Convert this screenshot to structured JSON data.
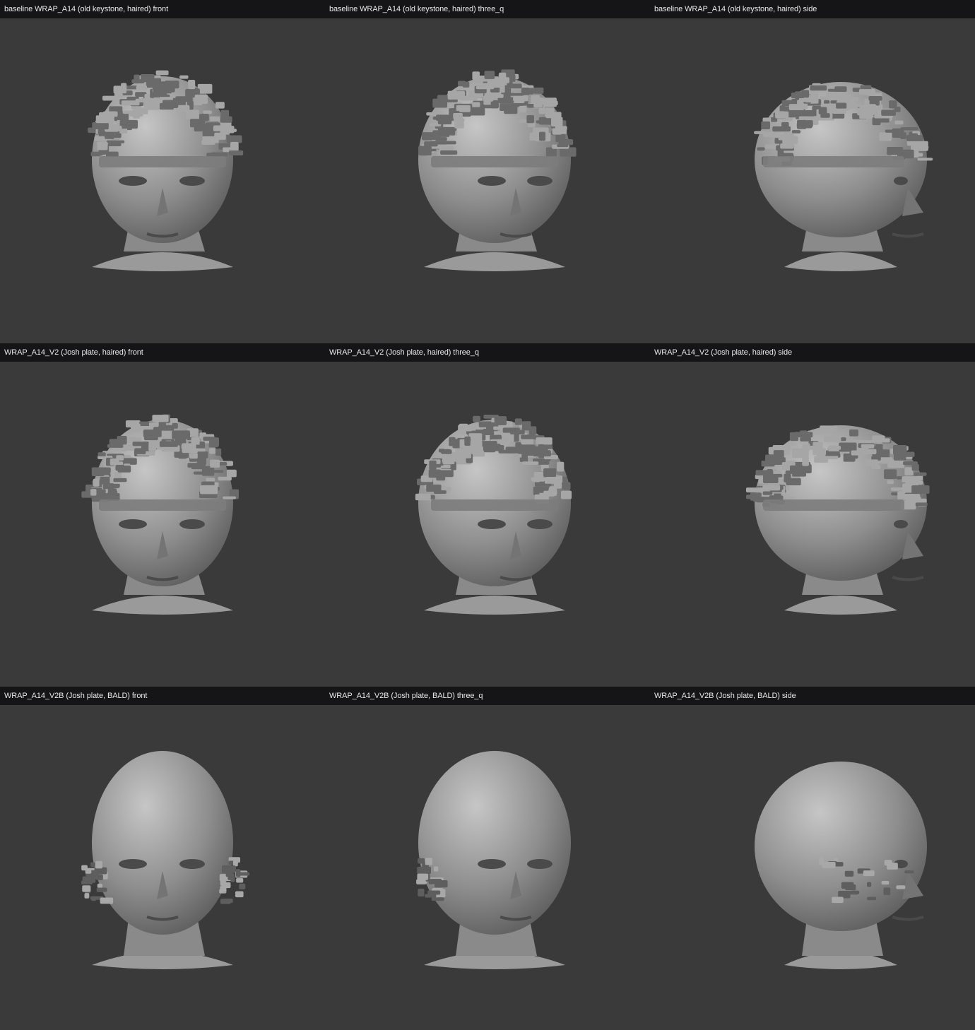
{
  "rows": [
    {
      "name": "baseline WRAP_A14 (old keystone, haired)",
      "hair": "haired",
      "views": [
        {
          "label": "baseline WRAP_A14 (old keystone, haired)  front",
          "view": "front"
        },
        {
          "label": "baseline WRAP_A14 (old keystone, haired)  three_q",
          "view": "three_q"
        },
        {
          "label": "baseline WRAP_A14 (old keystone, haired)  side",
          "view": "side"
        }
      ]
    },
    {
      "name": "WRAP_A14_V2 (Josh plate, haired)",
      "hair": "haired",
      "views": [
        {
          "label": "WRAP_A14_V2 (Josh plate, haired)  front",
          "view": "front"
        },
        {
          "label": "WRAP_A14_V2 (Josh plate, haired)  three_q",
          "view": "three_q"
        },
        {
          "label": "WRAP_A14_V2 (Josh plate, haired)  side",
          "view": "side"
        }
      ]
    },
    {
      "name": "WRAP_A14_V2B (Josh plate, BALD)",
      "hair": "bald",
      "views": [
        {
          "label": "WRAP_A14_V2B (Josh plate, BALD)  front",
          "view": "front"
        },
        {
          "label": "WRAP_A14_V2B (Josh plate, BALD)  three_q",
          "view": "three_q"
        },
        {
          "label": "WRAP_A14_V2B (Josh plate, BALD)  side",
          "view": "side"
        }
      ]
    }
  ],
  "colors": {
    "title_bar": "#151517",
    "title_text": "#e8e8e8",
    "viewport_bg": "#3a3a3a",
    "mesh_light": "#b4b4b4",
    "mesh_mid": "#8e8e8e",
    "mesh_dark": "#4a4a4a"
  }
}
